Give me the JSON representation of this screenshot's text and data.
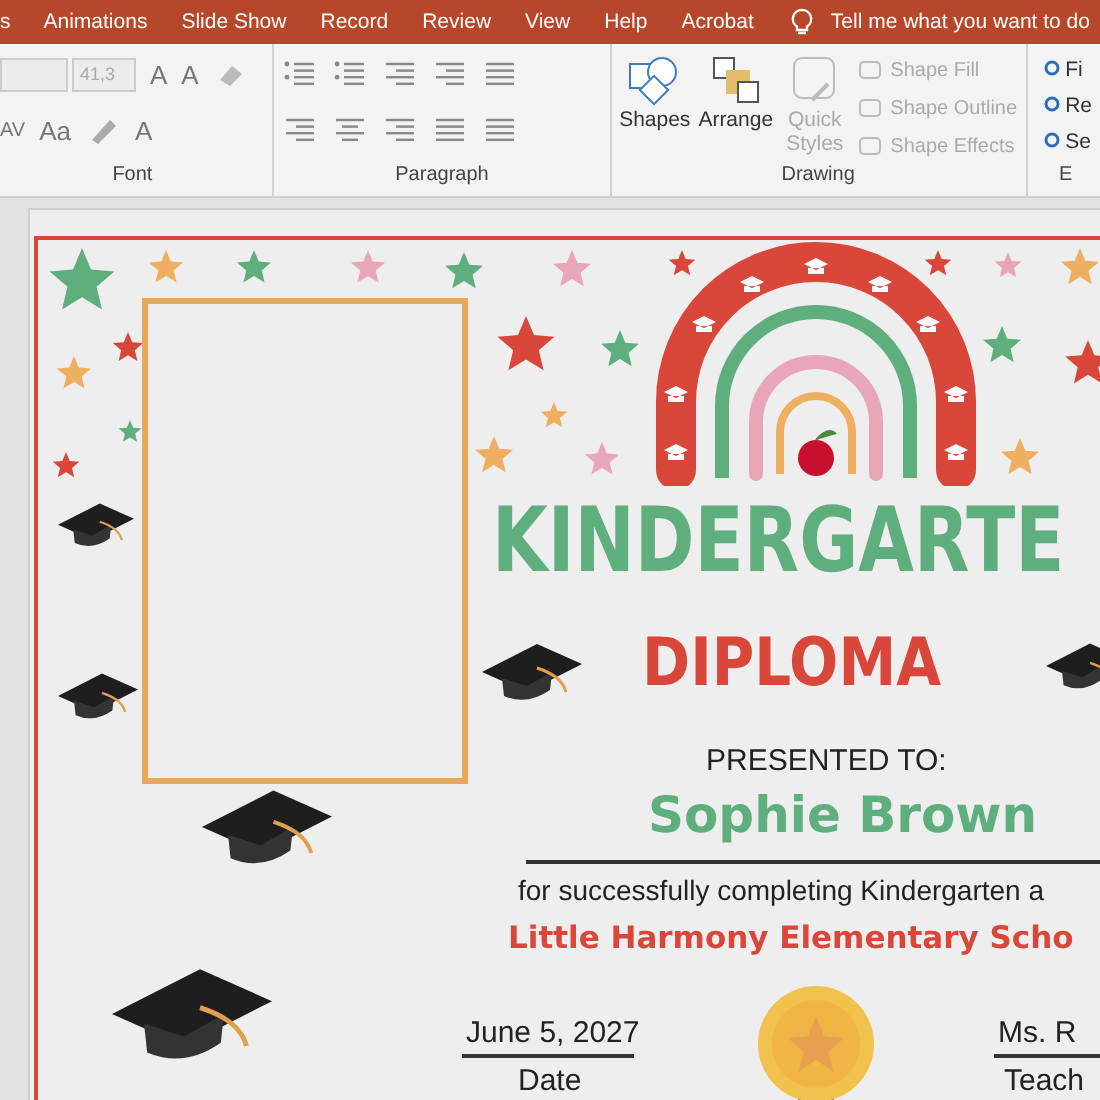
{
  "menu_tabs": [
    "s",
    "Animations",
    "Slide Show",
    "Record",
    "Review",
    "View",
    "Help",
    "Acrobat"
  ],
  "tell_me": "Tell me what you want to do",
  "ribbon": {
    "font": {
      "label": "Font",
      "size": "41,3",
      "row1_buttons": [
        "A",
        "A"
      ],
      "row2_buttons": [
        "AV",
        "Aa",
        "A"
      ]
    },
    "paragraph": {
      "label": "Paragraph"
    },
    "drawing": {
      "label": "Drawing",
      "buttons": [
        {
          "label": "Shapes",
          "disabled": false
        },
        {
          "label": "Arrange",
          "disabled": false
        },
        {
          "label": "Quick Styles",
          "disabled": true
        }
      ],
      "format": [
        {
          "label": "Shape Fill",
          "disabled": true
        },
        {
          "label": "Shape Outline",
          "disabled": true
        },
        {
          "label": "Shape Effects",
          "disabled": true
        }
      ]
    },
    "editing": {
      "label": "E",
      "items": [
        "Fi",
        "Re",
        "Se"
      ]
    }
  },
  "slide": {
    "title": "KINDERGARTE",
    "subtitle": "DIPLOMA",
    "presented": "PRESENTED TO:",
    "name": "Sophie Brown",
    "line": "for successfully completing Kindergarten a",
    "school": "Little Harmony Elementary Scho",
    "date": "June 5, 2027",
    "date_label": "Date",
    "teacher": "Ms. R",
    "teacher_label": "Teach"
  }
}
